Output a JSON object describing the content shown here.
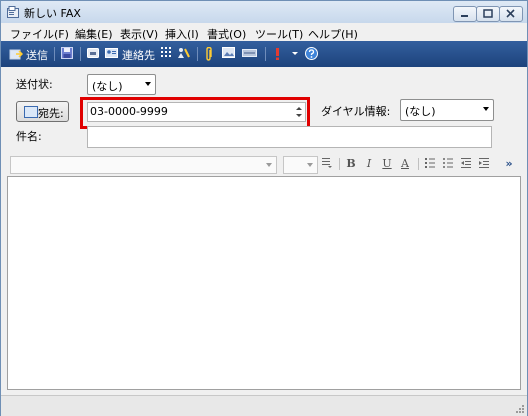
{
  "window": {
    "title": "新しい FAX"
  },
  "menu": [
    "ファイル(F)",
    "編集(E)",
    "表示(V)",
    "挿入(I)",
    "書式(O)",
    "ツール(T)",
    "ヘルプ(H)"
  ],
  "toolbar": {
    "send_label": "送信",
    "contacts_label": "連絡先",
    "bg_color": "#2a5089"
  },
  "form": {
    "cover_label": "送付状:",
    "cover_value": "(なし)",
    "to_button_label": "宛先:",
    "fax_number": "03-0000-9999",
    "dialing_label": "ダイヤル情報:",
    "dialing_value": "(なし)",
    "subject_label": "件名:",
    "subject_value": ""
  },
  "format": {
    "bold": "B",
    "italic": "I",
    "underline": "U",
    "font_color": "A",
    "more": "»"
  },
  "highlight_color": "#e00000"
}
